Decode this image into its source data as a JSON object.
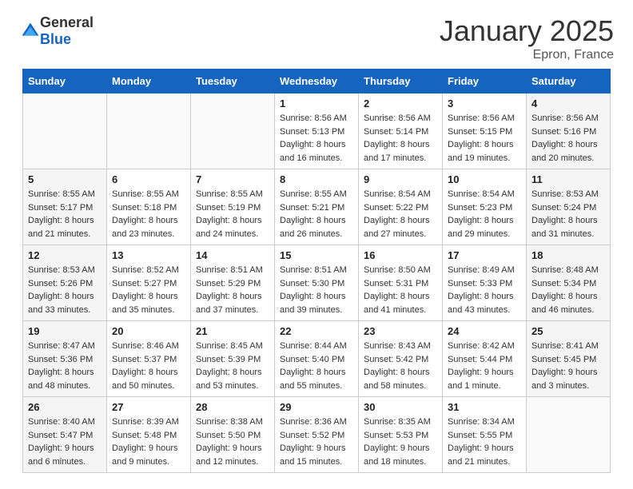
{
  "header": {
    "logo_general": "General",
    "logo_blue": "Blue",
    "month": "January 2025",
    "location": "Epron, France"
  },
  "days_of_week": [
    "Sunday",
    "Monday",
    "Tuesday",
    "Wednesday",
    "Thursday",
    "Friday",
    "Saturday"
  ],
  "weeks": [
    [
      {
        "day": "",
        "info": ""
      },
      {
        "day": "",
        "info": ""
      },
      {
        "day": "",
        "info": ""
      },
      {
        "day": "1",
        "info": "Sunrise: 8:56 AM\nSunset: 5:13 PM\nDaylight: 8 hours and 16 minutes."
      },
      {
        "day": "2",
        "info": "Sunrise: 8:56 AM\nSunset: 5:14 PM\nDaylight: 8 hours and 17 minutes."
      },
      {
        "day": "3",
        "info": "Sunrise: 8:56 AM\nSunset: 5:15 PM\nDaylight: 8 hours and 19 minutes."
      },
      {
        "day": "4",
        "info": "Sunrise: 8:56 AM\nSunset: 5:16 PM\nDaylight: 8 hours and 20 minutes."
      }
    ],
    [
      {
        "day": "5",
        "info": "Sunrise: 8:55 AM\nSunset: 5:17 PM\nDaylight: 8 hours and 21 minutes."
      },
      {
        "day": "6",
        "info": "Sunrise: 8:55 AM\nSunset: 5:18 PM\nDaylight: 8 hours and 23 minutes."
      },
      {
        "day": "7",
        "info": "Sunrise: 8:55 AM\nSunset: 5:19 PM\nDaylight: 8 hours and 24 minutes."
      },
      {
        "day": "8",
        "info": "Sunrise: 8:55 AM\nSunset: 5:21 PM\nDaylight: 8 hours and 26 minutes."
      },
      {
        "day": "9",
        "info": "Sunrise: 8:54 AM\nSunset: 5:22 PM\nDaylight: 8 hours and 27 minutes."
      },
      {
        "day": "10",
        "info": "Sunrise: 8:54 AM\nSunset: 5:23 PM\nDaylight: 8 hours and 29 minutes."
      },
      {
        "day": "11",
        "info": "Sunrise: 8:53 AM\nSunset: 5:24 PM\nDaylight: 8 hours and 31 minutes."
      }
    ],
    [
      {
        "day": "12",
        "info": "Sunrise: 8:53 AM\nSunset: 5:26 PM\nDaylight: 8 hours and 33 minutes."
      },
      {
        "day": "13",
        "info": "Sunrise: 8:52 AM\nSunset: 5:27 PM\nDaylight: 8 hours and 35 minutes."
      },
      {
        "day": "14",
        "info": "Sunrise: 8:51 AM\nSunset: 5:29 PM\nDaylight: 8 hours and 37 minutes."
      },
      {
        "day": "15",
        "info": "Sunrise: 8:51 AM\nSunset: 5:30 PM\nDaylight: 8 hours and 39 minutes."
      },
      {
        "day": "16",
        "info": "Sunrise: 8:50 AM\nSunset: 5:31 PM\nDaylight: 8 hours and 41 minutes."
      },
      {
        "day": "17",
        "info": "Sunrise: 8:49 AM\nSunset: 5:33 PM\nDaylight: 8 hours and 43 minutes."
      },
      {
        "day": "18",
        "info": "Sunrise: 8:48 AM\nSunset: 5:34 PM\nDaylight: 8 hours and 46 minutes."
      }
    ],
    [
      {
        "day": "19",
        "info": "Sunrise: 8:47 AM\nSunset: 5:36 PM\nDaylight: 8 hours and 48 minutes."
      },
      {
        "day": "20",
        "info": "Sunrise: 8:46 AM\nSunset: 5:37 PM\nDaylight: 8 hours and 50 minutes."
      },
      {
        "day": "21",
        "info": "Sunrise: 8:45 AM\nSunset: 5:39 PM\nDaylight: 8 hours and 53 minutes."
      },
      {
        "day": "22",
        "info": "Sunrise: 8:44 AM\nSunset: 5:40 PM\nDaylight: 8 hours and 55 minutes."
      },
      {
        "day": "23",
        "info": "Sunrise: 8:43 AM\nSunset: 5:42 PM\nDaylight: 8 hours and 58 minutes."
      },
      {
        "day": "24",
        "info": "Sunrise: 8:42 AM\nSunset: 5:44 PM\nDaylight: 9 hours and 1 minute."
      },
      {
        "day": "25",
        "info": "Sunrise: 8:41 AM\nSunset: 5:45 PM\nDaylight: 9 hours and 3 minutes."
      }
    ],
    [
      {
        "day": "26",
        "info": "Sunrise: 8:40 AM\nSunset: 5:47 PM\nDaylight: 9 hours and 6 minutes."
      },
      {
        "day": "27",
        "info": "Sunrise: 8:39 AM\nSunset: 5:48 PM\nDaylight: 9 hours and 9 minutes."
      },
      {
        "day": "28",
        "info": "Sunrise: 8:38 AM\nSunset: 5:50 PM\nDaylight: 9 hours and 12 minutes."
      },
      {
        "day": "29",
        "info": "Sunrise: 8:36 AM\nSunset: 5:52 PM\nDaylight: 9 hours and 15 minutes."
      },
      {
        "day": "30",
        "info": "Sunrise: 8:35 AM\nSunset: 5:53 PM\nDaylight: 9 hours and 18 minutes."
      },
      {
        "day": "31",
        "info": "Sunrise: 8:34 AM\nSunset: 5:55 PM\nDaylight: 9 hours and 21 minutes."
      },
      {
        "day": "",
        "info": ""
      }
    ]
  ]
}
